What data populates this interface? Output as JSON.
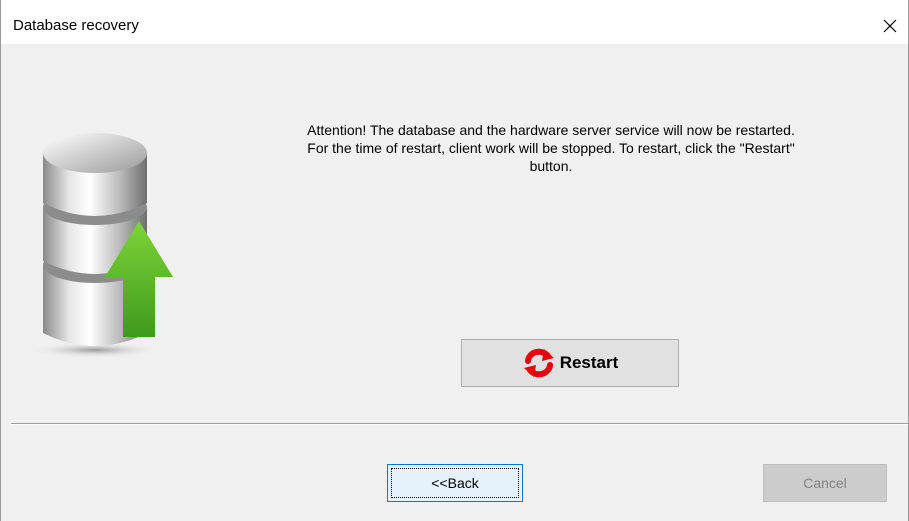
{
  "window": {
    "title": "Database recovery",
    "close_icon": "close-icon"
  },
  "main": {
    "icon": "database-upload-icon",
    "message_lines": [
      "Attention! The database and the hardware server service will now be restarted.",
      "For the time of restart, client work will be stopped. To restart, click the \"Restart\"",
      "button."
    ],
    "restart_button": {
      "label": "Restart",
      "icon": "restart-icon",
      "icon_color": "#e8000b"
    }
  },
  "footer": {
    "back_label": "<<Back",
    "cancel_label": "Cancel",
    "cancel_disabled": true
  },
  "colors": {
    "arrow_green": "#5fbf2a",
    "focus_border": "#0078d7"
  }
}
